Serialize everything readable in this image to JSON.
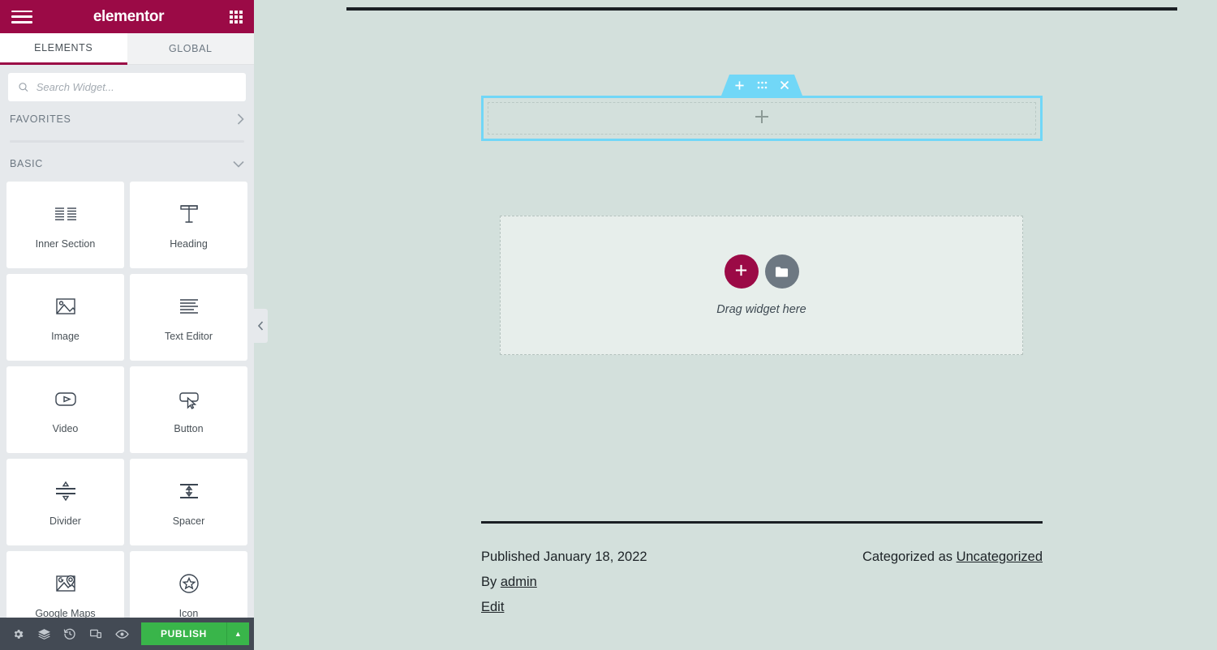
{
  "panel": {
    "header": {
      "brand": "elementor",
      "menu_icon": "hamburger-icon",
      "apps_icon": "apps-grid-icon"
    },
    "tabs": [
      {
        "label": "ELEMENTS",
        "active": true
      },
      {
        "label": "GLOBAL",
        "active": false
      }
    ],
    "search": {
      "placeholder": "Search Widget...",
      "value": "",
      "icon": "search-icon"
    },
    "categories": [
      {
        "label": "FAVORITES",
        "expanded": false,
        "chevron": "chevron-right-icon"
      },
      {
        "label": "BASIC",
        "expanded": true,
        "chevron": "chevron-down-icon"
      }
    ],
    "widgets": [
      {
        "label": "Inner Section",
        "icon": "columns-icon"
      },
      {
        "label": "Heading",
        "icon": "text-t-icon"
      },
      {
        "label": "Image",
        "icon": "image-icon"
      },
      {
        "label": "Text Editor",
        "icon": "paragraph-lines-icon"
      },
      {
        "label": "Video",
        "icon": "play-button-icon"
      },
      {
        "label": "Button",
        "icon": "button-cursor-icon"
      },
      {
        "label": "Divider",
        "icon": "divider-icon"
      },
      {
        "label": "Spacer",
        "icon": "spacer-icon"
      },
      {
        "label": "Google Maps",
        "icon": "map-pin-icon"
      },
      {
        "label": "Icon",
        "icon": "star-circle-icon"
      }
    ],
    "footer": {
      "buttons": [
        {
          "name": "settings",
          "icon": "gear-icon"
        },
        {
          "name": "navigator",
          "icon": "layers-icon"
        },
        {
          "name": "history",
          "icon": "history-clock-icon"
        },
        {
          "name": "responsive",
          "icon": "responsive-devices-icon"
        },
        {
          "name": "preview",
          "icon": "eye-icon"
        }
      ],
      "publish_label": "PUBLISH",
      "publish_arrow_icon": "caret-up-icon"
    },
    "collapse_icon": "chevron-left-icon"
  },
  "canvas": {
    "section_handle": {
      "add_icon": "plus-icon",
      "drag_icon": "drag-dots-icon",
      "close_icon": "close-x-icon"
    },
    "empty_section": {
      "add_icon": "plus-icon"
    },
    "dropzone": {
      "add_icon": "plus-icon",
      "folder_icon": "folder-icon",
      "text": "Drag widget here"
    },
    "post_meta": {
      "published": "Published January 18, 2022",
      "by_prefix": "By",
      "author": "admin",
      "edit": "Edit",
      "category_prefix": "Categorized as",
      "category": "Uncategorized"
    }
  },
  "colors": {
    "brand": "#9b0a46",
    "accent_blue": "#71d7f7",
    "publish_green": "#39b54a",
    "canvas_bg": "#d3e0dc",
    "panel_bg": "#e6e9ec",
    "footer_bg": "#434a54"
  }
}
